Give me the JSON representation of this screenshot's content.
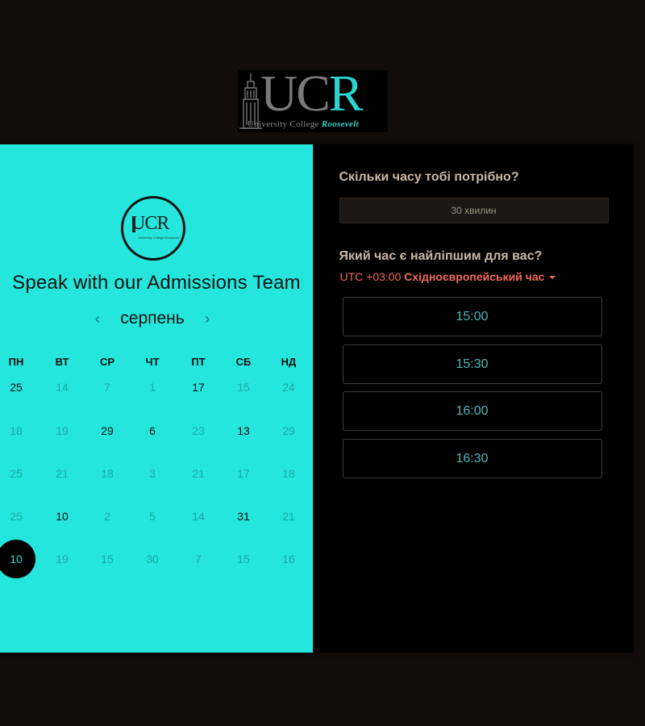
{
  "brand": {
    "logo_letters": "UCR",
    "logo_sub_prefix": "University College ",
    "logo_sub_highlight": "Roosevelt",
    "colors": {
      "accent": "#24e6dc",
      "teal": "#2bd4cf",
      "timezone": "#f06a5a",
      "background": "#120d0b"
    }
  },
  "calendar": {
    "title": "Speak with our Admissions Team",
    "month": "серпень",
    "prev_icon": "chevron-left-icon",
    "next_icon": "chevron-right-icon",
    "weekdays": [
      "ПН",
      "ВТ",
      "СР",
      "ЧТ",
      "ПТ",
      "СБ",
      "НД"
    ],
    "weeks": [
      [
        {
          "d": "25",
          "active": true
        },
        {
          "d": "14"
        },
        {
          "d": "7"
        },
        {
          "d": "1"
        },
        {
          "d": "17",
          "active": true
        },
        {
          "d": "15"
        },
        {
          "d": "24"
        }
      ],
      [
        {
          "d": "18"
        },
        {
          "d": "19"
        },
        {
          "d": "29",
          "active": true
        },
        {
          "d": "6",
          "active": true
        },
        {
          "d": "23"
        },
        {
          "d": "13",
          "active": true
        },
        {
          "d": "29"
        }
      ],
      [
        {
          "d": "25"
        },
        {
          "d": "21"
        },
        {
          "d": "18"
        },
        {
          "d": "3"
        },
        {
          "d": "21"
        },
        {
          "d": "17"
        },
        {
          "d": "18"
        }
      ],
      [
        {
          "d": "25"
        },
        {
          "d": "10",
          "active": true
        },
        {
          "d": "2"
        },
        {
          "d": "5"
        },
        {
          "d": "14"
        },
        {
          "d": "31",
          "active": true
        },
        {
          "d": "21"
        }
      ],
      [
        {
          "d": "10",
          "selected": true
        },
        {
          "d": "19"
        },
        {
          "d": "15"
        },
        {
          "d": "30"
        },
        {
          "d": "7"
        },
        {
          "d": "15"
        },
        {
          "d": "16"
        }
      ]
    ]
  },
  "booking": {
    "duration_question": "Скільки часу тобі потрібно?",
    "duration_value": "30 хвилин",
    "time_question": "Який час є найліпшим для вас?",
    "timezone_offset": "UTC +03:00",
    "timezone_name": "Східноєвропейський час",
    "timezone_caret_icon": "caret-down-icon",
    "slots": [
      "15:00",
      "15:30",
      "16:00",
      "16:30"
    ]
  }
}
